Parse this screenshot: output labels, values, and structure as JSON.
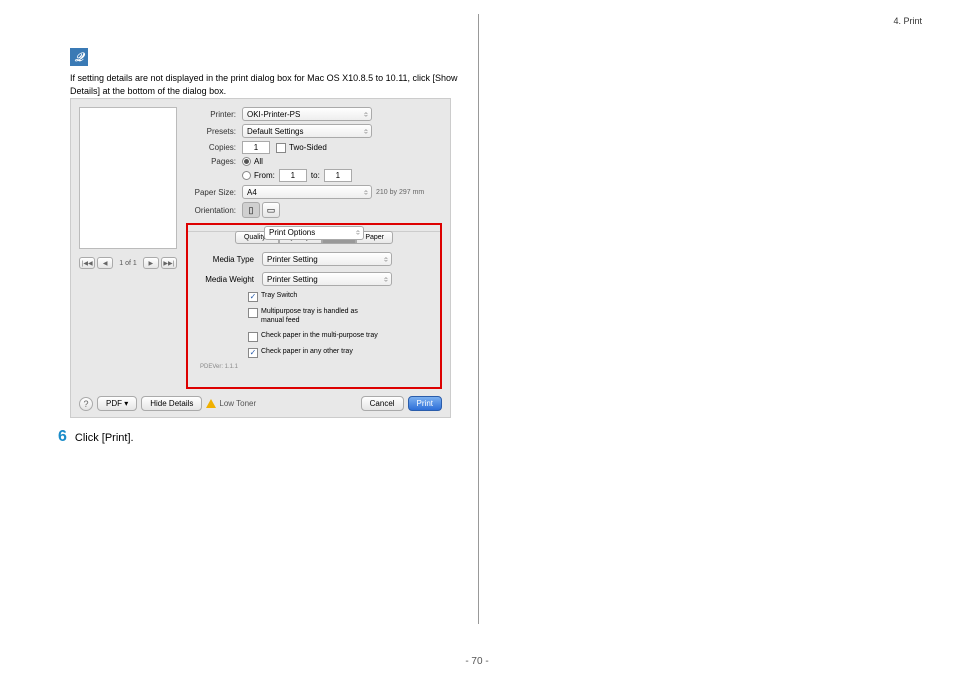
{
  "header": {
    "section": "4. Print"
  },
  "note": {
    "icon_label": "note-icon",
    "text": "If setting details are not displayed in the print dialog box for Mac OS X10.8.5 to 10.11, click [Show Details] at the bottom of the dialog box."
  },
  "dialog": {
    "printer": {
      "label": "Printer:",
      "value": "OKI-Printer-PS"
    },
    "presets": {
      "label": "Presets:",
      "value": "Default Settings"
    },
    "copies": {
      "label": "Copies:",
      "value": "1",
      "two_sided_label": "Two-Sided",
      "two_sided_checked": false
    },
    "pages": {
      "label": "Pages:",
      "all_label": "All",
      "all_checked": true,
      "from_label": "From:",
      "from_value": "1",
      "to_label": "to:",
      "to_value": "1"
    },
    "paper_size": {
      "label": "Paper Size:",
      "value": "A4",
      "dims": "210 by 297 mm"
    },
    "orientation": {
      "label": "Orientation:"
    },
    "panel": {
      "value": "Print Options"
    },
    "tabs": {
      "q1": "Quality1",
      "q2": "Quality2",
      "feed": "Feed",
      "paper": "Paper"
    },
    "media_type": {
      "label": "Media Type",
      "value": "Printer Setting"
    },
    "media_weight": {
      "label": "Media Weight",
      "value": "Printer Setting"
    },
    "checks": {
      "tray_switch": "Tray Switch",
      "mpt_manual": "Multipurpose tray is handled as manual feed",
      "check_mpt": "Check paper in the multi-purpose tray",
      "check_other": "Check paper in any other tray"
    },
    "version": "PDEVer: 1.1.1",
    "page_nav": "1 of 1",
    "footer": {
      "help": "?",
      "pdf": "PDF ▾",
      "hide": "Hide Details",
      "low_toner": "Low Toner",
      "cancel": "Cancel",
      "print": "Print"
    }
  },
  "step": {
    "num": "6",
    "text": "Click [Print]."
  },
  "page_number": "- 70 -"
}
